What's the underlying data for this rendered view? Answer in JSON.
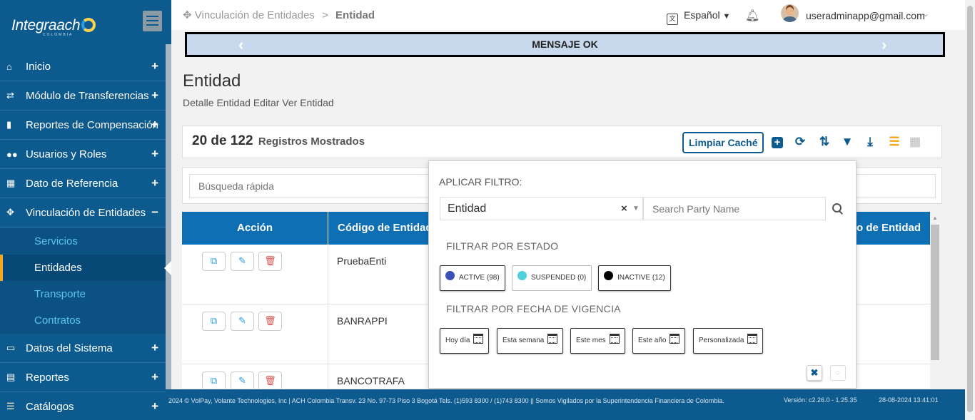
{
  "app": {
    "logo_text": "Integraach",
    "logo_sub": "COLOMBIA",
    "colors": {
      "primary": "#0d5a8f",
      "table_header": "#0f6fb5",
      "accent": "#f3a81b",
      "submenu_link": "#5cc4ee",
      "banner": "#c9d9ed"
    }
  },
  "sidebar": {
    "items": [
      {
        "label": "Inicio",
        "icon": "home-icon",
        "sign": "+"
      },
      {
        "label": "Módulo de Transferencias",
        "icon": "transfer-icon",
        "sign": "+"
      },
      {
        "label": "Reportes de Compensación",
        "icon": "file-icon",
        "sign": "+"
      },
      {
        "label": "Usuarios y Roles",
        "icon": "users-icon",
        "sign": "+"
      },
      {
        "label": "Dato de Referencia",
        "icon": "calendar-icon",
        "sign": "+"
      },
      {
        "label": "Vinculación de Entidades",
        "icon": "arrows-icon",
        "sign": "−"
      },
      {
        "label": "Datos del Sistema",
        "icon": "monitor-icon",
        "sign": "+"
      },
      {
        "label": "Reportes",
        "icon": "report-icon",
        "sign": "+"
      },
      {
        "label": "Catálogos",
        "icon": "list-icon",
        "sign": "+"
      }
    ],
    "submenu": [
      "Servicios",
      "Entidades",
      "Transporte",
      "Contratos"
    ]
  },
  "topbar": {
    "breadcrumb_parent": "Vinculación de Entidades",
    "breadcrumb_sep": ">",
    "breadcrumb_current": "Entidad",
    "language": "Español",
    "user_email": "useradminapp@gmail.com"
  },
  "banner": {
    "message": "MENSAJE OK"
  },
  "page": {
    "title": "Entidad",
    "subtitle": "Detalle Entidad Editar Ver Entidad"
  },
  "records": {
    "count": "20 de 122",
    "label": "Registros Mostrados",
    "cache_button": "Limpiar Caché"
  },
  "search": {
    "placeholder": "Búsqueda rápida"
  },
  "table": {
    "headers": [
      "Acción",
      "Código de Entidad",
      "po de Entidad"
    ],
    "rows": [
      {
        "code": "PruebaEnti"
      },
      {
        "code": "BANRAPPI"
      },
      {
        "code": "BANCOTRAFA"
      }
    ]
  },
  "filter": {
    "title": "APLICAR FILTRO:",
    "field_select": "Entidad",
    "party_placeholder": "Search Party Name",
    "status_section": "FILTRAR POR ESTADO",
    "statuses": [
      {
        "label": "ACTIVE (98)",
        "color": "#3a4fb8"
      },
      {
        "label": "SUSPENDED (0)",
        "color": "#4fd0dd"
      },
      {
        "label": "INACTIVE (12)",
        "color": "#000000"
      }
    ],
    "date_section": "FILTRAR POR FECHA DE VIGENCIA",
    "dates": [
      "Hoy día",
      "Esta semana",
      "Este mes",
      "Este año",
      "Personalizada"
    ]
  },
  "footer": {
    "text": "2024 © VolPay, Volante Technologies, Inc | ACH Colombia Transv. 23 No. 97-73 Piso 3 Bogotá Tels. (1)593 8300 / (1)743 8300 || Somos Vigilados por la Superintendencia Financiera de Colombia.",
    "version": "Versión: c2.26.0 - 1.25.35",
    "datetime": "28-08-2024 13:41:01"
  }
}
